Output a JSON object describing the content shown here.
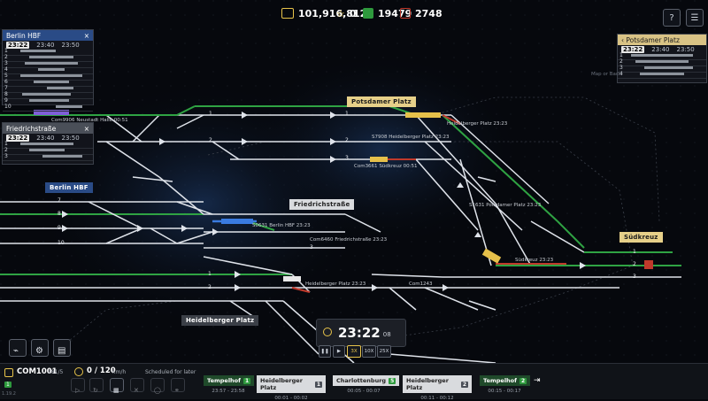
{
  "resources": {
    "money": "101,916,812",
    "stars": "0",
    "green_count": "19479",
    "red_count": "2748",
    "colors": {
      "money": "#e8c44a",
      "green": "#2e9a3d",
      "red": "#c0392b"
    }
  },
  "top_buttons": [
    "help-icon",
    "list-icon"
  ],
  "panels": {
    "berlin_hbf": {
      "title": "Berlin HBF",
      "now": "23:22",
      "times": [
        "23:40",
        "23:50"
      ],
      "rows": [
        "1",
        "2",
        "3",
        "4",
        "5",
        "6",
        "7",
        "8",
        "9",
        "10"
      ]
    },
    "friedrichstrasse": {
      "title": "Friedrichstraße",
      "now": "23:22",
      "times": [
        "23:40",
        "23:50"
      ],
      "rows": [
        "1",
        "2",
        "3"
      ]
    },
    "potsdamer_platz": {
      "title": "Potsdamer Platz",
      "now": "23:22",
      "times": [
        "23:40",
        "23:50"
      ],
      "rows": [
        "1",
        "2",
        "3",
        "4"
      ]
    }
  },
  "stations": {
    "potsdamer_platz": "Potsdamer Platz",
    "berlin_hbf": "Berlin HBF",
    "friedrichstrasse": "Friedrichstraße",
    "heidelberger_platz": "Heidelberger Platz",
    "suedkreuz": "Südkreuz"
  },
  "train_labels": {
    "com9906": "Com9906",
    "com9906_dest": "Neustadt Halle",
    "com9906_time": "00:51",
    "potsdam_top_dest": "Heidelberger Platz",
    "potsdam_top_time": "23:23",
    "s7908": "S7908",
    "s7908_dest": "Heidelberger Platz",
    "s7908_time": "23:23",
    "com3661": "Com3661",
    "com3661_dest": "Südkreuz",
    "com3661_time": "00:51",
    "s1631": "S1631",
    "s1631_dest": "Potsdamer Platz",
    "s1631_time": "23:23",
    "s0631": "S0631",
    "s0631_dest": "Berlin HBF",
    "s0631_time": "23:23",
    "com6460": "Com6460",
    "com6460_dest": "Friedrichstraße",
    "com6460_time": "23:23",
    "suedkreuz_train_dest": "Südkreuz",
    "suedkreuz_train_time": "23:23",
    "lower_dest": "Heidelberger Platz",
    "lower_time": "23:23",
    "com1243": "Com1243",
    "map_hint": "Map or Back"
  },
  "clock": {
    "time": "23:22",
    "seconds": "08"
  },
  "speeds": [
    "3X",
    "10X",
    "25X"
  ],
  "train_info": {
    "name": "COM1001",
    "ratio": "181/5",
    "speed": "0 / 120",
    "unit": "km/h",
    "status": "Scheduled for later",
    "count": "1",
    "version": "1.19.2"
  },
  "schedule": [
    {
      "name": "Tempelhof",
      "platform": "1",
      "time": "23:57 - 23:58",
      "active": true
    },
    {
      "name": "Heidelberger Platz",
      "platform": "1",
      "time": "00:01 - 00:02",
      "active": false
    },
    {
      "name": "Charlottenburg",
      "platform": "5",
      "time": "00:05 - 00:07",
      "active": false
    },
    {
      "name": "Heidelberger Platz",
      "platform": "2",
      "time": "00:11 - 00:12",
      "active": false
    },
    {
      "name": "Tempelhof",
      "platform": "2",
      "time": "00:15 - 00:17",
      "active": true
    }
  ],
  "track_numbers": [
    "1",
    "2",
    "3",
    "4",
    "5",
    "6",
    "7",
    "8",
    "9",
    "10",
    "11"
  ]
}
